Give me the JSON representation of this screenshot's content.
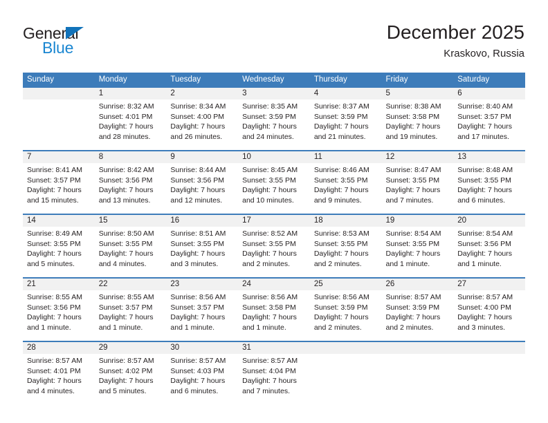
{
  "brand": {
    "name_dark": "General",
    "name_light": "Blue",
    "triangle_color": "#1273ba",
    "text_color": "#1a86d1"
  },
  "header": {
    "title": "December 2025",
    "subtitle": "Kraskovo, Russia"
  },
  "theme": {
    "header_band": "#3d7cba",
    "daynum_band": "#f1f1f1",
    "text": "#231f20"
  },
  "weekday_headers": [
    "Sunday",
    "Monday",
    "Tuesday",
    "Wednesday",
    "Thursday",
    "Friday",
    "Saturday"
  ],
  "weeks": [
    [
      {
        "day": "",
        "lines": []
      },
      {
        "day": "1",
        "lines": [
          "Sunrise: 8:32 AM",
          "Sunset: 4:01 PM",
          "Daylight: 7 hours",
          "and 28 minutes."
        ]
      },
      {
        "day": "2",
        "lines": [
          "Sunrise: 8:34 AM",
          "Sunset: 4:00 PM",
          "Daylight: 7 hours",
          "and 26 minutes."
        ]
      },
      {
        "day": "3",
        "lines": [
          "Sunrise: 8:35 AM",
          "Sunset: 3:59 PM",
          "Daylight: 7 hours",
          "and 24 minutes."
        ]
      },
      {
        "day": "4",
        "lines": [
          "Sunrise: 8:37 AM",
          "Sunset: 3:59 PM",
          "Daylight: 7 hours",
          "and 21 minutes."
        ]
      },
      {
        "day": "5",
        "lines": [
          "Sunrise: 8:38 AM",
          "Sunset: 3:58 PM",
          "Daylight: 7 hours",
          "and 19 minutes."
        ]
      },
      {
        "day": "6",
        "lines": [
          "Sunrise: 8:40 AM",
          "Sunset: 3:57 PM",
          "Daylight: 7 hours",
          "and 17 minutes."
        ]
      }
    ],
    [
      {
        "day": "7",
        "lines": [
          "Sunrise: 8:41 AM",
          "Sunset: 3:57 PM",
          "Daylight: 7 hours",
          "and 15 minutes."
        ]
      },
      {
        "day": "8",
        "lines": [
          "Sunrise: 8:42 AM",
          "Sunset: 3:56 PM",
          "Daylight: 7 hours",
          "and 13 minutes."
        ]
      },
      {
        "day": "9",
        "lines": [
          "Sunrise: 8:44 AM",
          "Sunset: 3:56 PM",
          "Daylight: 7 hours",
          "and 12 minutes."
        ]
      },
      {
        "day": "10",
        "lines": [
          "Sunrise: 8:45 AM",
          "Sunset: 3:55 PM",
          "Daylight: 7 hours",
          "and 10 minutes."
        ]
      },
      {
        "day": "11",
        "lines": [
          "Sunrise: 8:46 AM",
          "Sunset: 3:55 PM",
          "Daylight: 7 hours",
          "and 9 minutes."
        ]
      },
      {
        "day": "12",
        "lines": [
          "Sunrise: 8:47 AM",
          "Sunset: 3:55 PM",
          "Daylight: 7 hours",
          "and 7 minutes."
        ]
      },
      {
        "day": "13",
        "lines": [
          "Sunrise: 8:48 AM",
          "Sunset: 3:55 PM",
          "Daylight: 7 hours",
          "and 6 minutes."
        ]
      }
    ],
    [
      {
        "day": "14",
        "lines": [
          "Sunrise: 8:49 AM",
          "Sunset: 3:55 PM",
          "Daylight: 7 hours",
          "and 5 minutes."
        ]
      },
      {
        "day": "15",
        "lines": [
          "Sunrise: 8:50 AM",
          "Sunset: 3:55 PM",
          "Daylight: 7 hours",
          "and 4 minutes."
        ]
      },
      {
        "day": "16",
        "lines": [
          "Sunrise: 8:51 AM",
          "Sunset: 3:55 PM",
          "Daylight: 7 hours",
          "and 3 minutes."
        ]
      },
      {
        "day": "17",
        "lines": [
          "Sunrise: 8:52 AM",
          "Sunset: 3:55 PM",
          "Daylight: 7 hours",
          "and 2 minutes."
        ]
      },
      {
        "day": "18",
        "lines": [
          "Sunrise: 8:53 AM",
          "Sunset: 3:55 PM",
          "Daylight: 7 hours",
          "and 2 minutes."
        ]
      },
      {
        "day": "19",
        "lines": [
          "Sunrise: 8:54 AM",
          "Sunset: 3:55 PM",
          "Daylight: 7 hours",
          "and 1 minute."
        ]
      },
      {
        "day": "20",
        "lines": [
          "Sunrise: 8:54 AM",
          "Sunset: 3:56 PM",
          "Daylight: 7 hours",
          "and 1 minute."
        ]
      }
    ],
    [
      {
        "day": "21",
        "lines": [
          "Sunrise: 8:55 AM",
          "Sunset: 3:56 PM",
          "Daylight: 7 hours",
          "and 1 minute."
        ]
      },
      {
        "day": "22",
        "lines": [
          "Sunrise: 8:55 AM",
          "Sunset: 3:57 PM",
          "Daylight: 7 hours",
          "and 1 minute."
        ]
      },
      {
        "day": "23",
        "lines": [
          "Sunrise: 8:56 AM",
          "Sunset: 3:57 PM",
          "Daylight: 7 hours",
          "and 1 minute."
        ]
      },
      {
        "day": "24",
        "lines": [
          "Sunrise: 8:56 AM",
          "Sunset: 3:58 PM",
          "Daylight: 7 hours",
          "and 1 minute."
        ]
      },
      {
        "day": "25",
        "lines": [
          "Sunrise: 8:56 AM",
          "Sunset: 3:59 PM",
          "Daylight: 7 hours",
          "and 2 minutes."
        ]
      },
      {
        "day": "26",
        "lines": [
          "Sunrise: 8:57 AM",
          "Sunset: 3:59 PM",
          "Daylight: 7 hours",
          "and 2 minutes."
        ]
      },
      {
        "day": "27",
        "lines": [
          "Sunrise: 8:57 AM",
          "Sunset: 4:00 PM",
          "Daylight: 7 hours",
          "and 3 minutes."
        ]
      }
    ],
    [
      {
        "day": "28",
        "lines": [
          "Sunrise: 8:57 AM",
          "Sunset: 4:01 PM",
          "Daylight: 7 hours",
          "and 4 minutes."
        ]
      },
      {
        "day": "29",
        "lines": [
          "Sunrise: 8:57 AM",
          "Sunset: 4:02 PM",
          "Daylight: 7 hours",
          "and 5 minutes."
        ]
      },
      {
        "day": "30",
        "lines": [
          "Sunrise: 8:57 AM",
          "Sunset: 4:03 PM",
          "Daylight: 7 hours",
          "and 6 minutes."
        ]
      },
      {
        "day": "31",
        "lines": [
          "Sunrise: 8:57 AM",
          "Sunset: 4:04 PM",
          "Daylight: 7 hours",
          "and 7 minutes."
        ]
      },
      {
        "day": "",
        "lines": []
      },
      {
        "day": "",
        "lines": []
      },
      {
        "day": "",
        "lines": []
      }
    ]
  ]
}
